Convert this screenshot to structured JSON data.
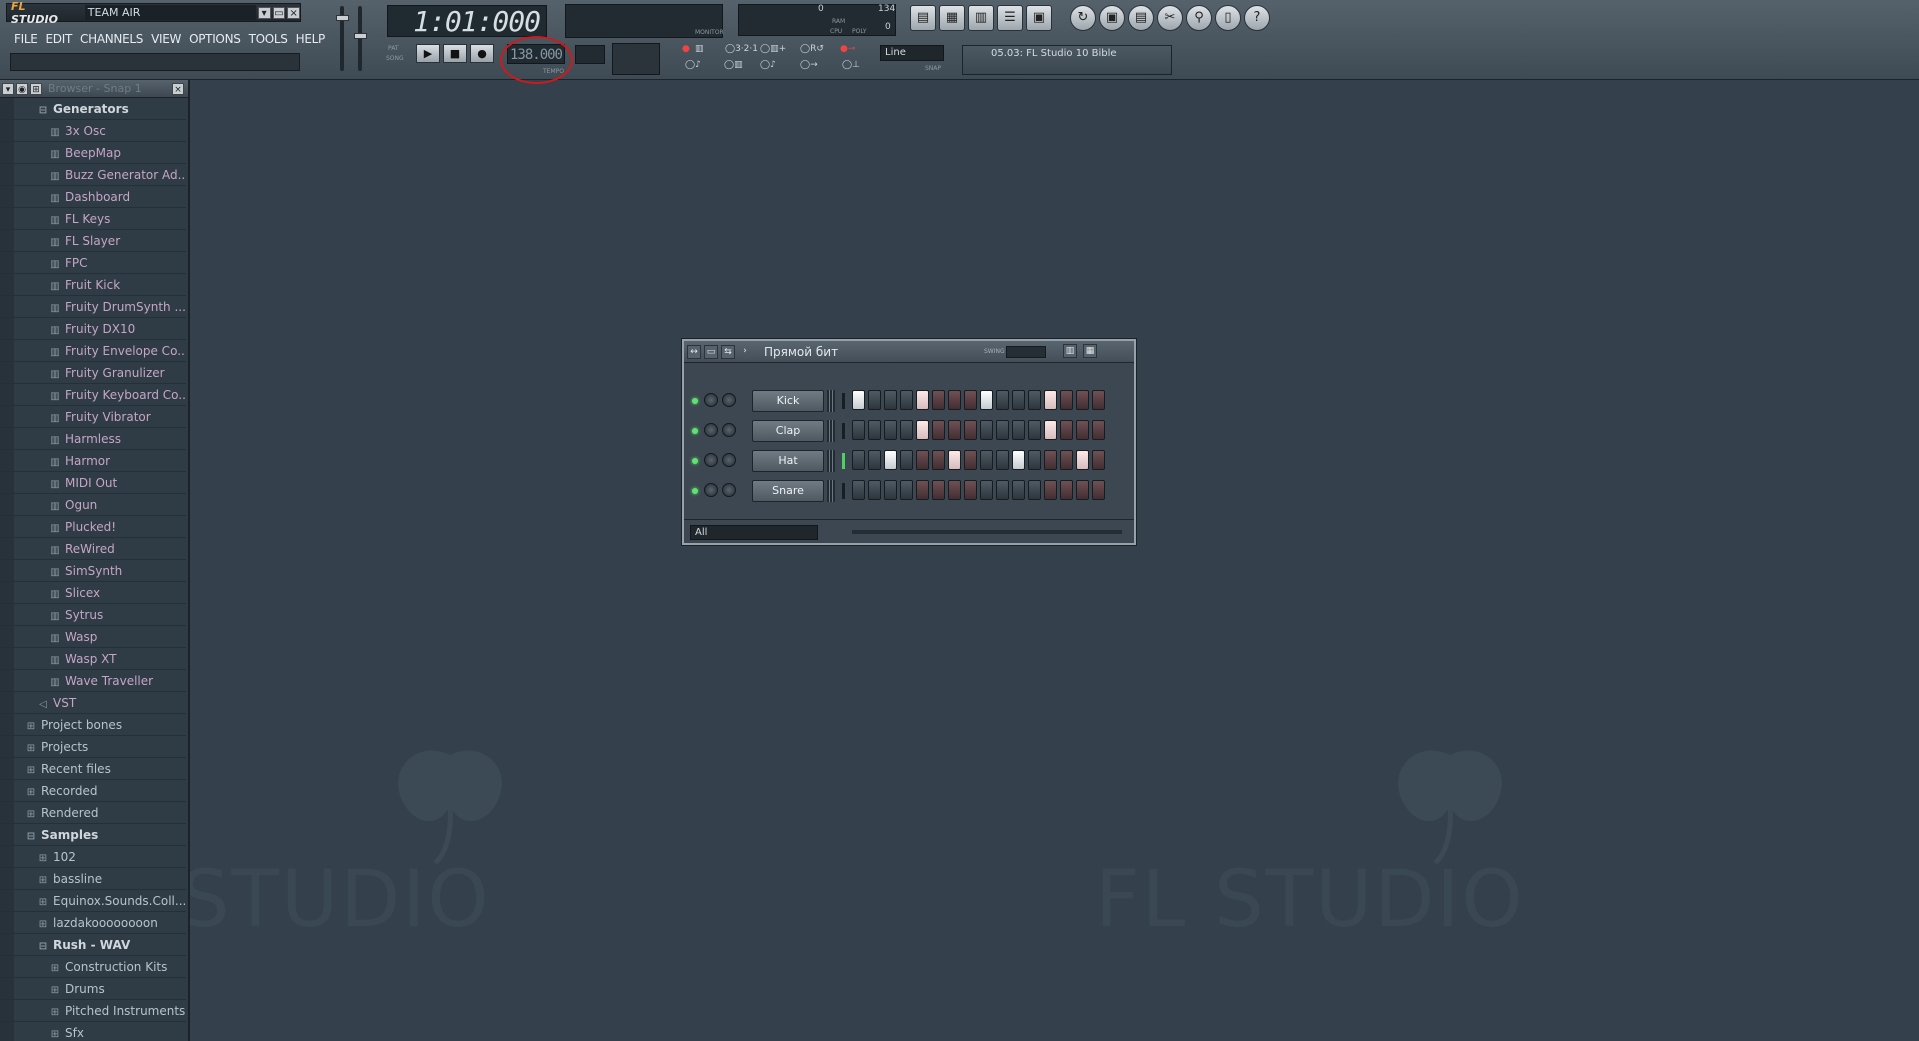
{
  "app": {
    "logo_text": "FL STUDIO",
    "title": "TEAM AIR",
    "window_buttons": [
      "▾",
      "▭",
      "×"
    ]
  },
  "menu": [
    "FILE",
    "EDIT",
    "CHANNELS",
    "VIEW",
    "OPTIONS",
    "TOOLS",
    "HELP"
  ],
  "transport": {
    "time": "1:01:000",
    "tempo": "138.000",
    "tempo_label": "TEMPO",
    "pat_label": "PAT",
    "song_label": "SONG",
    "play_icon": "▶",
    "stop_icon": "■",
    "record_icon": "●",
    "monitor_label": "MONITOR",
    "cpu_label": "CPU",
    "poly_label": "POLY",
    "ram_label": "RAM",
    "cpu_value": "0",
    "poly_value": "0",
    "ram_value": "134",
    "snap_label": "SNAP",
    "line_select": "Line",
    "song_select": "05.03: FL Studio 10 Bible"
  },
  "toolbar_icons": [
    "playlist-icon",
    "step-sequencer-icon",
    "piano-roll-icon",
    "browser-icon",
    "mixer-icon",
    "undo-icon",
    "save-icon",
    "render-icon",
    "cut-icon",
    "magnifier-icon",
    "document-icon",
    "help-icon"
  ],
  "browser": {
    "title": "Browser - Snap 1",
    "close_icon": "×",
    "items": [
      {
        "label": "Generators",
        "level": 1,
        "kind": "open"
      },
      {
        "label": "3x Osc",
        "level": 2,
        "kind": "plugin"
      },
      {
        "label": "BeepMap",
        "level": 2,
        "kind": "plugin"
      },
      {
        "label": "Buzz Generator Ad...",
        "level": 2,
        "kind": "plugin"
      },
      {
        "label": "Dashboard",
        "level": 2,
        "kind": "plugin"
      },
      {
        "label": "FL Keys",
        "level": 2,
        "kind": "plugin"
      },
      {
        "label": "FL Slayer",
        "level": 2,
        "kind": "plugin"
      },
      {
        "label": "FPC",
        "level": 2,
        "kind": "plugin"
      },
      {
        "label": "Fruit Kick",
        "level": 2,
        "kind": "plugin"
      },
      {
        "label": "Fruity DrumSynth ...",
        "level": 2,
        "kind": "plugin"
      },
      {
        "label": "Fruity DX10",
        "level": 2,
        "kind": "plugin"
      },
      {
        "label": "Fruity Envelope Co...",
        "level": 2,
        "kind": "plugin"
      },
      {
        "label": "Fruity Granulizer",
        "level": 2,
        "kind": "plugin"
      },
      {
        "label": "Fruity Keyboard Co...",
        "level": 2,
        "kind": "plugin"
      },
      {
        "label": "Fruity Vibrator",
        "level": 2,
        "kind": "plugin"
      },
      {
        "label": "Harmless",
        "level": 2,
        "kind": "plugin"
      },
      {
        "label": "Harmor",
        "level": 2,
        "kind": "plugin"
      },
      {
        "label": "MIDI Out",
        "level": 2,
        "kind": "plugin"
      },
      {
        "label": "Ogun",
        "level": 2,
        "kind": "plugin"
      },
      {
        "label": "Plucked!",
        "level": 2,
        "kind": "plugin"
      },
      {
        "label": "ReWired",
        "level": 2,
        "kind": "plugin"
      },
      {
        "label": "SimSynth",
        "level": 2,
        "kind": "plugin"
      },
      {
        "label": "Slicex",
        "level": 2,
        "kind": "plugin"
      },
      {
        "label": "Sytrus",
        "level": 2,
        "kind": "plugin"
      },
      {
        "label": "Wasp",
        "level": 2,
        "kind": "plugin"
      },
      {
        "label": "Wasp XT",
        "level": 2,
        "kind": "plugin"
      },
      {
        "label": "Wave Traveller",
        "level": 2,
        "kind": "plugin"
      },
      {
        "label": "VST",
        "level": 1,
        "kind": "vst"
      },
      {
        "label": "Project bones",
        "level": 0,
        "kind": "folder"
      },
      {
        "label": "Projects",
        "level": 0,
        "kind": "folder"
      },
      {
        "label": "Recent files",
        "level": 0,
        "kind": "folder"
      },
      {
        "label": "Recorded",
        "level": 0,
        "kind": "folder"
      },
      {
        "label": "Rendered",
        "level": 0,
        "kind": "folder"
      },
      {
        "label": "Samples",
        "level": 0,
        "kind": "open"
      },
      {
        "label": "102",
        "level": 1,
        "kind": "folder"
      },
      {
        "label": "bassline",
        "level": 1,
        "kind": "folder"
      },
      {
        "label": "Equinox.Sounds.Coll...",
        "level": 1,
        "kind": "folder"
      },
      {
        "label": "lazdakoooooooon",
        "level": 1,
        "kind": "folder"
      },
      {
        "label": "Rush - WAV",
        "level": 1,
        "kind": "open"
      },
      {
        "label": "Construction Kits",
        "level": 2,
        "kind": "folder"
      },
      {
        "label": "Drums",
        "level": 2,
        "kind": "folder"
      },
      {
        "label": "Pitched Instruments",
        "level": 2,
        "kind": "folder"
      },
      {
        "label": "Sfx",
        "level": 2,
        "kind": "folder"
      }
    ]
  },
  "watermark": "FL STUDIO",
  "watermark_left": "STUDIO",
  "sequencer": {
    "pattern_name": "Прямой бит",
    "swing_label": "SWING",
    "filter": "All",
    "channels": [
      {
        "name": "Kick",
        "steps": [
          1,
          0,
          0,
          0,
          1,
          0,
          0,
          0,
          1,
          0,
          0,
          0,
          1,
          0,
          0,
          0
        ],
        "active": false
      },
      {
        "name": "Clap",
        "steps": [
          0,
          0,
          0,
          0,
          1,
          0,
          0,
          0,
          0,
          0,
          0,
          0,
          1,
          0,
          0,
          0
        ],
        "active": false
      },
      {
        "name": "Hat",
        "steps": [
          0,
          0,
          1,
          0,
          0,
          0,
          1,
          0,
          0,
          0,
          1,
          0,
          0,
          0,
          1,
          0
        ],
        "active": true
      },
      {
        "name": "Snare",
        "steps": [
          0,
          0,
          0,
          0,
          0,
          0,
          0,
          0,
          0,
          0,
          0,
          0,
          0,
          0,
          0,
          0
        ],
        "active": false
      }
    ]
  },
  "colors": {
    "background": "#34414c",
    "tempo_highlight": "#d0191b",
    "led_green": "#5ee36e",
    "browser_plugin_text": "#c5a6c6"
  }
}
